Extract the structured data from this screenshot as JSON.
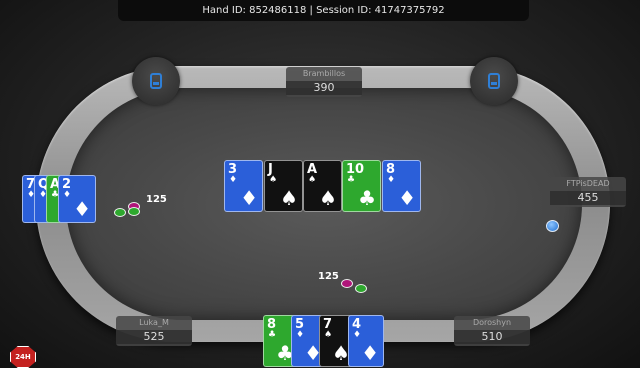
{
  "hand_info": "Hand ID: 852486118 | Session ID: 41747375792",
  "colors": {
    "diamonds": "#2b5fd9",
    "clubs": "#2ea82e",
    "spades": "#111111",
    "hearts": "#c81e1e",
    "felt": "#4a4a4a",
    "rail": "#a3a3a3"
  },
  "suit_symbols": {
    "diamonds": "♦",
    "clubs": "♣",
    "spades": "♠",
    "hearts": "♥"
  },
  "players": {
    "top": {
      "name": "Brambillos",
      "stack": "390"
    },
    "right": {
      "name": "FTPisDEAD",
      "stack": "455"
    },
    "bottom_left": {
      "name": "Luka_M",
      "stack": "525"
    },
    "bottom_right": {
      "name": "Doroshyn",
      "stack": "510"
    }
  },
  "board": [
    {
      "rank": "3",
      "suit": "diamonds"
    },
    {
      "rank": "J",
      "suit": "spades"
    },
    {
      "rank": "A",
      "suit": "spades"
    },
    {
      "rank": "10",
      "suit": "clubs"
    },
    {
      "rank": "8",
      "suit": "diamonds"
    }
  ],
  "hero_hand": [
    {
      "rank": "8",
      "suit": "clubs"
    },
    {
      "rank": "5",
      "suit": "diamonds"
    },
    {
      "rank": "7",
      "suit": "spades"
    },
    {
      "rank": "4",
      "suit": "diamonds"
    }
  ],
  "left_hand": [
    {
      "rank": "7",
      "suit": "diamonds"
    },
    {
      "rank": "Q",
      "suit": "diamonds"
    },
    {
      "rank": "A",
      "suit": "clubs"
    },
    {
      "rank": "2",
      "suit": "diamonds"
    }
  ],
  "bets": {
    "left": "125",
    "center": "125"
  },
  "timer_badge": "24H"
}
